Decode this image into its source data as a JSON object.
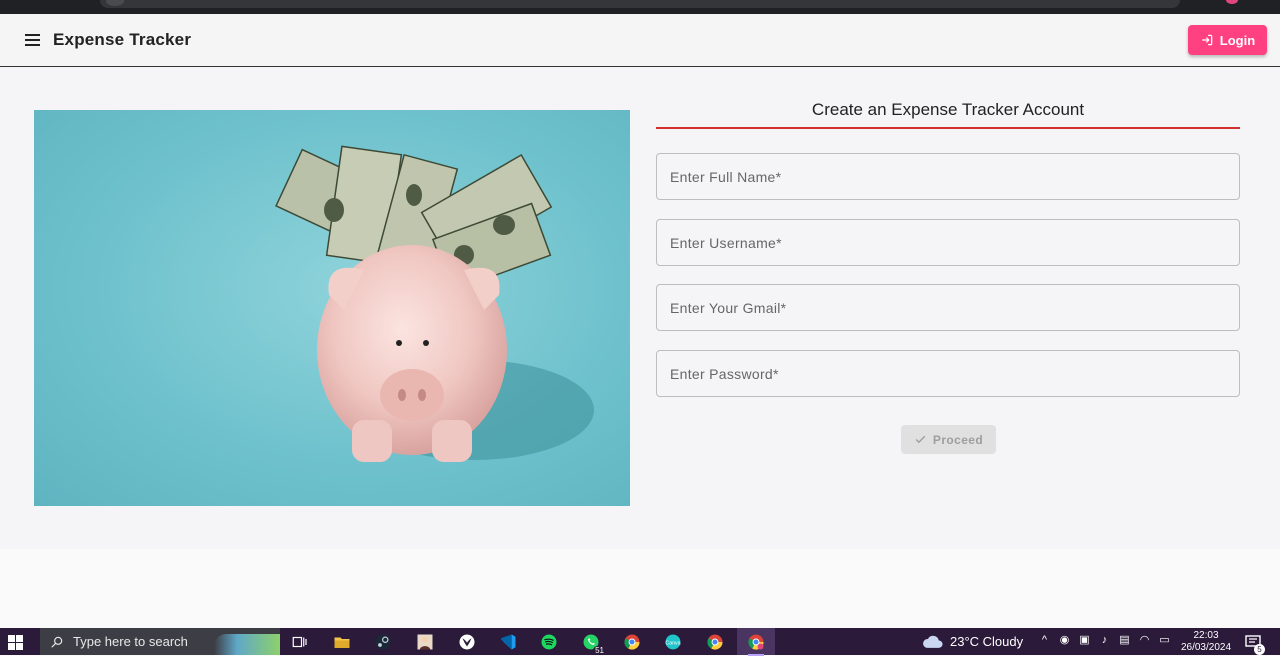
{
  "app": {
    "title": "Expense Tracker",
    "login_label": "Login",
    "accent_color": "#ff4081",
    "underline_color": "#d32f2f"
  },
  "form": {
    "heading": "Create an Expense Tracker Account",
    "fields": [
      {
        "placeholder": "Enter Full Name*",
        "value": ""
      },
      {
        "placeholder": "Enter Username*",
        "value": ""
      },
      {
        "placeholder": "Enter Your Gmail*",
        "value": ""
      },
      {
        "placeholder": "Enter Password*",
        "value": ""
      }
    ],
    "submit_label": "Proceed",
    "submit_disabled": true
  },
  "hero": {
    "icon": "piggy-bank-with-dollar-bills"
  },
  "taskbar": {
    "search_placeholder": "Type here to search",
    "weather_text": "23°C  Cloudy",
    "clock_time": "22:03",
    "clock_date": "26/03/2024",
    "whatsapp_badge": "51",
    "notification_count": "5",
    "apps": [
      "task-view",
      "file-explorer",
      "steam",
      "photo-app",
      "xbox",
      "vscode",
      "spotify",
      "whatsapp",
      "chrome",
      "canva",
      "chrome-profile-2",
      "chrome-profile-3"
    ]
  }
}
